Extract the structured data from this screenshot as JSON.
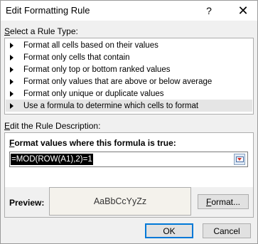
{
  "window": {
    "title": "Edit Formatting Rule",
    "help_label": "?",
    "close_label": "✕"
  },
  "rule_type": {
    "label_prefix": "",
    "label_mnemonic": "S",
    "label_rest": "elect a Rule Type:",
    "items": [
      "Format all cells based on their values",
      "Format only cells that contain",
      "Format only top or bottom ranked values",
      "Format only values that are above or below average",
      "Format only unique or duplicate values",
      "Use a formula to determine which cells to format"
    ],
    "selected_index": 5
  },
  "description": {
    "label_mnemonic": "E",
    "label_rest": "dit the Rule Description:",
    "formula_label_mnemonic": "F",
    "formula_label_rest": "ormat values where this formula is true:",
    "formula_value": "=MOD(ROW(A1),2)=1",
    "preview_label": "Preview:",
    "preview_sample": "AaBbCcYyZz",
    "format_button_mnemonic": "F",
    "format_button_rest": "ormat..."
  },
  "footer": {
    "ok_label": "OK",
    "cancel_label": "Cancel"
  },
  "icons": {
    "collapse": "collapse-dialog-icon",
    "item_arrow": "right-triangle-icon"
  }
}
